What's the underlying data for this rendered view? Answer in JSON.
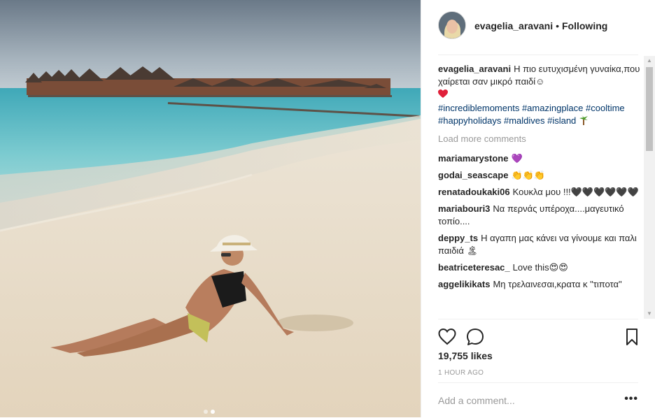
{
  "post": {
    "username": "evagelia_aravani",
    "separator": "•",
    "follow_status": "Following",
    "caption": {
      "username": "evagelia_aravani",
      "text": "Η πιο ευτυχισμένη γυναίκα,που χαίρεται σαν μικρό παιδί☺",
      "hashtags": "#incrediblemoments #amazingplace #cooltime #happyholidays #maldives #island",
      "heart_emoji": "red-heart",
      "palm_emoji": "palm-tree"
    },
    "load_more_label": "Load more comments",
    "comments": [
      {
        "user": "mariamarystone",
        "text": "💜"
      },
      {
        "user": "godai_seascape",
        "text": "👏👏👏"
      },
      {
        "user": "renatadoukaki06",
        "text": "Κουκλα μου !!!🖤🖤🖤🖤🖤🖤"
      },
      {
        "user": "mariabouri3",
        "text": "Να περνάς υπέροχα....μαγευτικό τοπίο...."
      },
      {
        "user": "deppy_ts",
        "text": "Η αγαπη μας κάνει να γίνουμε και παλι παιδιά 🏝"
      },
      {
        "user": "beatriceteresac_",
        "text": "Love this😍😍"
      },
      {
        "user": "aggelikikats",
        "text": "Μη τρελαινεσαι,κρατα κ \"τιποτα\""
      }
    ],
    "likes": "19,755 likes",
    "time_ago": "1 HOUR AGO",
    "add_comment_placeholder": "Add a comment...",
    "more_options": "•••",
    "carousel": {
      "count": 2,
      "active_index": 1
    },
    "colors": {
      "link": "#003569",
      "muted": "#999999",
      "text": "#262626",
      "border": "#efefef",
      "heart": "#ed4956"
    },
    "icons": [
      "heart-outline-icon",
      "comment-bubble-icon",
      "bookmark-icon",
      "ellipsis-icon"
    ]
  }
}
